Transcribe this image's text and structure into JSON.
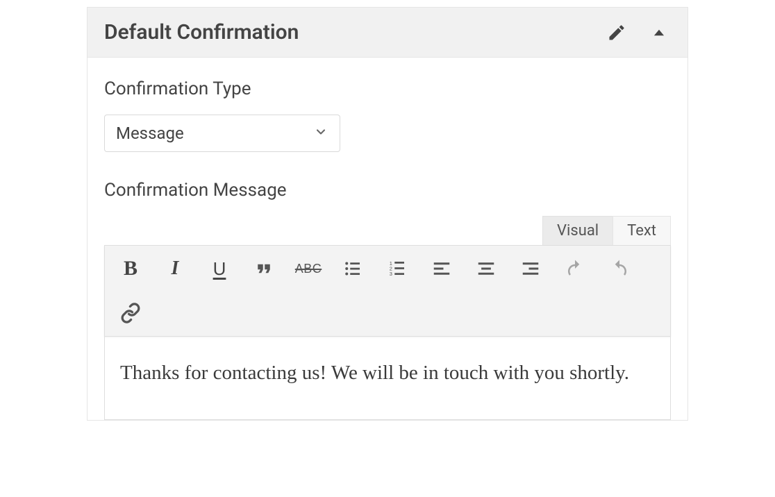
{
  "panel": {
    "title": "Default Confirmation"
  },
  "fields": {
    "type_label": "Confirmation Type",
    "type_value": "Message",
    "message_label": "Confirmation Message"
  },
  "editor": {
    "tabs": {
      "visual": "Visual",
      "text": "Text",
      "active": "visual"
    },
    "content": "Thanks for contacting us! We will be in touch with you shortly.",
    "tools": {
      "strike": "ABC"
    }
  }
}
